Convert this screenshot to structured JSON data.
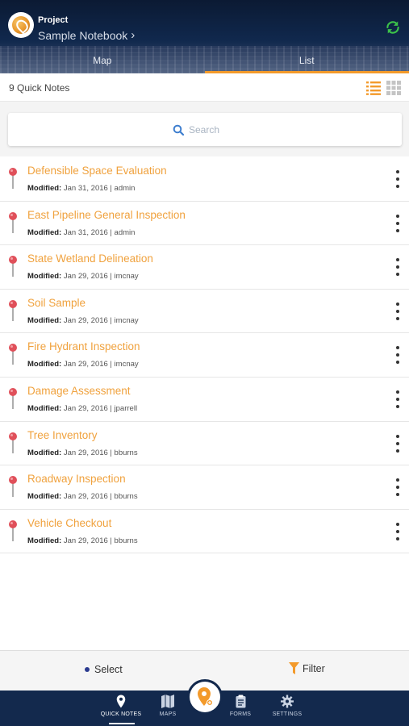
{
  "header": {
    "project_label": "Project",
    "project_name": "Sample Notebook",
    "tabs": [
      {
        "label": "Map",
        "active": false
      },
      {
        "label": "List",
        "active": true
      }
    ]
  },
  "subheader": {
    "count_text": "9 Quick Notes"
  },
  "search": {
    "placeholder": "Search"
  },
  "notes": [
    {
      "title": "Defensible Space Evaluation",
      "modified_label": "Modified:",
      "meta": " Jan 31, 2016 | admin"
    },
    {
      "title": "East Pipeline General Inspection",
      "modified_label": "Modified:",
      "meta": " Jan 31, 2016 | admin"
    },
    {
      "title": "State Wetland Delineation",
      "modified_label": "Modified:",
      "meta": " Jan 29, 2016 | imcnay"
    },
    {
      "title": "Soil Sample",
      "modified_label": "Modified:",
      "meta": " Jan 29, 2016 | imcnay"
    },
    {
      "title": "Fire Hydrant Inspection",
      "modified_label": "Modified:",
      "meta": " Jan 29, 2016 | imcnay"
    },
    {
      "title": "Damage Assessment",
      "modified_label": "Modified:",
      "meta": " Jan 29, 2016 | jparrell"
    },
    {
      "title": "Tree Inventory",
      "modified_label": "Modified:",
      "meta": " Jan 29, 2016 | bburns"
    },
    {
      "title": "Roadway Inspection",
      "modified_label": "Modified:",
      "meta": " Jan 29, 2016 | bburns"
    },
    {
      "title": "Vehicle Checkout",
      "modified_label": "Modified:",
      "meta": " Jan 29, 2016 | bburns"
    }
  ],
  "action_bar": {
    "select_label": "Select",
    "filter_label": "Filter"
  },
  "bottom_nav": {
    "items": [
      {
        "label": "QUICK NOTES",
        "icon": "pin-icon",
        "active": true
      },
      {
        "label": "MAPS",
        "icon": "map-icon",
        "active": false
      },
      {
        "label": "FORMS",
        "icon": "clipboard-icon",
        "active": false
      },
      {
        "label": "SETTINGS",
        "icon": "gear-icon",
        "active": false
      }
    ]
  },
  "colors": {
    "header_bg": "#10284d",
    "accent_orange": "#f39a2b",
    "title_orange": "#f0a23e",
    "pin_red": "#e0505a",
    "sync_green": "#3cc24a",
    "nav_bg": "#13294d"
  }
}
